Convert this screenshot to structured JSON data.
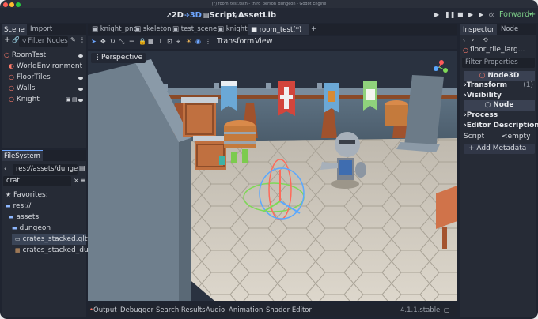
{
  "window": {
    "title": "(*) room_test.tscn - third_person_dungeon - Godot Engine"
  },
  "main_modes": {
    "mode_2d": "2D",
    "mode_3d": "3D",
    "script": "Script",
    "assetlib": "AssetLib"
  },
  "renderer": {
    "label": "Forward+"
  },
  "scene_dock": {
    "tabs": {
      "scene": "Scene",
      "import": "Import"
    },
    "filter_placeholder": "Filter Nodes",
    "nodes": [
      {
        "name": "RoomTest"
      },
      {
        "name": "WorldEnvironment"
      },
      {
        "name": "FloorTiles"
      },
      {
        "name": "Walls"
      },
      {
        "name": "Knight"
      }
    ]
  },
  "filesystem_dock": {
    "tab": "FileSystem",
    "path": "res://assets/dunge",
    "search_value": "crat",
    "items": [
      {
        "label": "Favorites:"
      },
      {
        "label": "res://"
      },
      {
        "label": "assets"
      },
      {
        "label": "dungeon"
      },
      {
        "label": "crates_stacked.gltf.c"
      },
      {
        "label": "crates_stacked_dun"
      }
    ]
  },
  "editor_tabs": [
    {
      "label": "knight_pnc"
    },
    {
      "label": "skeleton"
    },
    {
      "label": "test_scene"
    },
    {
      "label": "knight"
    },
    {
      "label": "room_test(*)"
    }
  ],
  "viewport_toolbar": {
    "transform": "Transform",
    "view": "View"
  },
  "viewport": {
    "perspective_label": "Perspective"
  },
  "bottom_panel": {
    "tabs": [
      "Output",
      "Debugger",
      "Search Results",
      "Audio",
      "Animation",
      "Shader Editor"
    ],
    "version": "4.1.1.stable"
  },
  "inspector": {
    "tabs": {
      "inspector": "Inspector",
      "node": "Node"
    },
    "object_name": "floor_tile_larg...",
    "filter_placeholder": "Filter Properties",
    "class_label": "Node3D",
    "sections": [
      {
        "label": "Transform",
        "count": "(1)"
      },
      {
        "label": "Visibility"
      }
    ],
    "node_class": "Node",
    "sections2": [
      {
        "label": "Process"
      },
      {
        "label": "Editor Description"
      }
    ],
    "script_label": "Script",
    "script_value": "<empty",
    "add_metadata": "Add Metadata"
  },
  "colors": {
    "accent": "#6ea6ff",
    "bg": "#1f2430",
    "panel": "#262b36",
    "mode2d": "#9ac0ff",
    "mode3d": "#6ea6ff"
  }
}
